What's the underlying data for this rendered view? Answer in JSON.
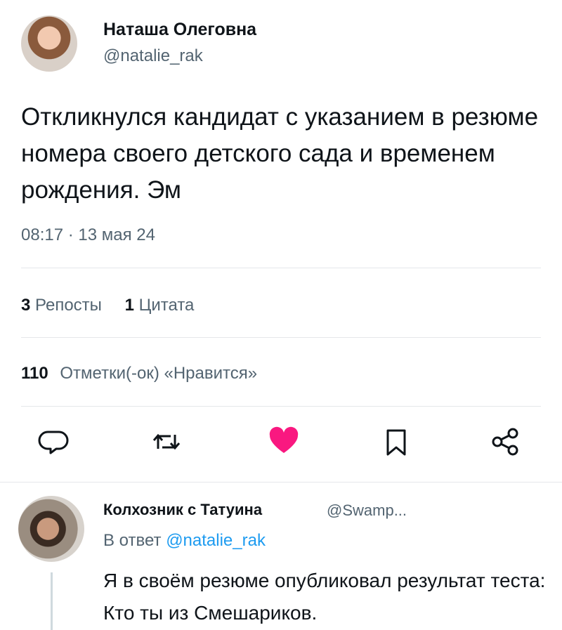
{
  "tweet": {
    "author_name": "Наташа Олеговна",
    "author_handle": "@natalie_rak",
    "text": "Откликнулся кандидат с указанием в резюме номера своего детского сада и временем рождения. Эм",
    "timestamp": "08:17 · 13 мая 24"
  },
  "stats": {
    "reposts_count": "3",
    "reposts_label": "Репосты",
    "quotes_count": "1",
    "quotes_label": "Цитата",
    "likes_count": "110",
    "likes_label": "Отметки(-ок) «Нравится»"
  },
  "actions": {
    "reply_icon": "reply-icon",
    "repost_icon": "repost-icon",
    "like_icon": "heart-icon",
    "like_color": "#f91880",
    "bookmark_icon": "bookmark-icon",
    "share_icon": "share-icon"
  },
  "reply": {
    "author_name": "Колхозник с Татуина",
    "author_handle": "@Swamp...",
    "reply_to_prefix": "В ответ",
    "reply_to_handle": "@natalie_rak",
    "text": "Я в своём резюме опубликовал результат теста: Кто ты из Смешариков."
  }
}
